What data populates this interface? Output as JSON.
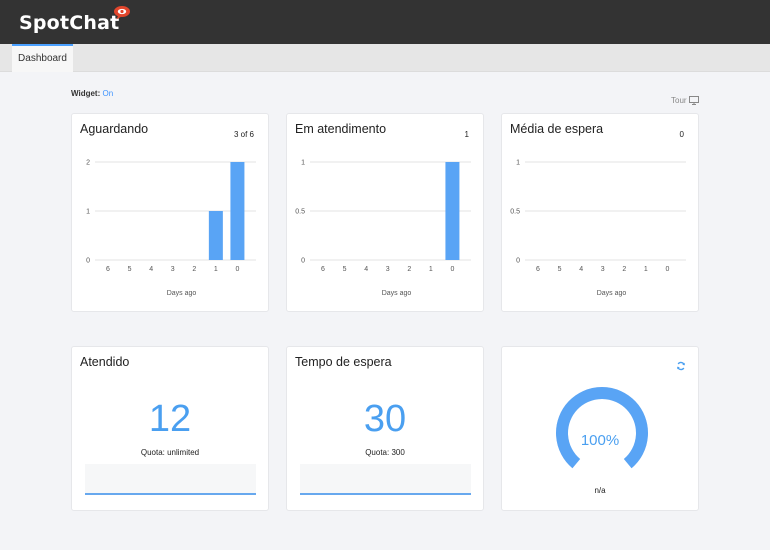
{
  "app": {
    "brand": "SpotChat"
  },
  "nav": {
    "tabs": [
      {
        "label": "Dashboard"
      }
    ]
  },
  "toolbar": {
    "widget_label": "Widget:",
    "widget_value": "On",
    "tour_label": "Tour"
  },
  "colors": {
    "accent": "#4a9ff0",
    "bar": "#59a4f5",
    "topbar": "#333333",
    "background": "#f3f4f7"
  },
  "cards": {
    "aguardando": {
      "title": "Aguardando",
      "count": "3 of 6",
      "chart_data": {
        "type": "bar",
        "categories": [
          "6",
          "5",
          "4",
          "3",
          "2",
          "1",
          "0"
        ],
        "values": [
          0,
          0,
          0,
          0,
          0,
          1,
          2
        ],
        "ylim": [
          0,
          2
        ],
        "yticks": [
          "0",
          "1",
          "2"
        ],
        "xlabel": "Days ago"
      }
    },
    "em_atendimento": {
      "title": "Em atendimento",
      "count": "1",
      "chart_data": {
        "type": "bar",
        "categories": [
          "6",
          "5",
          "4",
          "3",
          "2",
          "1",
          "0"
        ],
        "values": [
          0,
          0,
          0,
          0,
          0,
          0,
          1
        ],
        "ylim": [
          0,
          1
        ],
        "yticks": [
          "0",
          "0.5",
          "1"
        ],
        "xlabel": "Days ago"
      }
    },
    "media_espera": {
      "title": "Média de espera",
      "count": "0",
      "chart_data": {
        "type": "bar",
        "categories": [
          "6",
          "5",
          "4",
          "3",
          "2",
          "1",
          "0"
        ],
        "values": [
          0,
          0,
          0,
          0,
          0,
          0,
          0
        ],
        "ylim": [
          0,
          1
        ],
        "yticks": [
          "0",
          "0.5",
          "1"
        ],
        "xlabel": "Days ago"
      }
    },
    "atendido": {
      "title": "Atendido",
      "value": "12",
      "quota": "Quota: unlimited"
    },
    "tempo_espera": {
      "title": "Tempo de espera",
      "value": "30",
      "quota": "Quota: 300"
    },
    "gauge": {
      "value_label": "100%",
      "fraction": 1.0,
      "sub": "n/a",
      "icon": "refresh-icon"
    }
  }
}
